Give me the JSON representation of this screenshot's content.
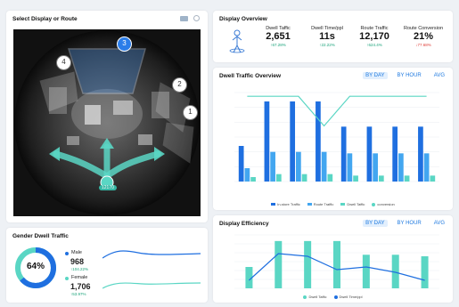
{
  "colors": {
    "blue": "#1f6fe0",
    "light_blue": "#43a6f0",
    "teal": "#5ad6c4",
    "down": "#e0403a",
    "up": "#1aa37a"
  },
  "camera": {
    "title": "Select Display or Route",
    "icons": [
      "grid-view-icon",
      "settings-icon"
    ],
    "zones": [
      {
        "label": "1"
      },
      {
        "label": "2"
      },
      {
        "label": "3"
      },
      {
        "label": "4"
      }
    ],
    "route_label": "12170"
  },
  "overview": {
    "title": "Display Overview",
    "icon": "person-display-icon",
    "metrics": [
      {
        "label": "Dwell Taffic",
        "value": "2,651",
        "delta": "↑67.28%",
        "trend": "up"
      },
      {
        "label": "Dwell Time/ppl",
        "value": "11s",
        "delta": "↑22.22%",
        "trend": "up"
      },
      {
        "label": "Route Traffic",
        "value": "12,170",
        "delta": "↑624.4%",
        "trend": "up"
      },
      {
        "label": "Route Conversion",
        "value": "21%",
        "delta": "↓77.68%",
        "trend": "down"
      }
    ]
  },
  "gender": {
    "title": "Gender Dwell Traffic",
    "ring_value": "64%",
    "male_share": 0.64,
    "male": {
      "label": "Male",
      "value": "968",
      "delta": "↑104.22%"
    },
    "female": {
      "label": "Female",
      "value": "1,706",
      "delta": "↑53.97%"
    }
  },
  "dwell_traffic": {
    "title": "Dwell Traffic Overview",
    "tabs": [
      "BY DAY",
      "BY HOUR",
      "AVG"
    ],
    "legend": [
      "In-store Traffic",
      "Route Traffic",
      "Dwell Taffic",
      "conversion"
    ]
  },
  "efficiency": {
    "title": "Display Efficiency",
    "tabs": [
      "BY DAY",
      "BY HOUR",
      "AVG"
    ],
    "legend": [
      "Dwell Taffic",
      "Dwell Time/ppl"
    ]
  },
  "chart_data": [
    {
      "type": "bar",
      "categories": [
        "",
        "",
        "",
        "",
        "",
        "",
        "",
        ""
      ],
      "ylim": [
        0,
        6000
      ],
      "y2lim": [
        0,
        12
      ],
      "grid": true,
      "legend": "bottom",
      "series": [
        {
          "name": "In-store Traffic",
          "type": "bar",
          "values": [
            2400,
            5400,
            5400,
            5400,
            3700,
            3700,
            3700,
            3700
          ]
        },
        {
          "name": "Route Traffic",
          "type": "bar",
          "values": [
            900,
            2000,
            2000,
            2000,
            1900,
            1900,
            1900,
            1900
          ]
        },
        {
          "name": "Dwell Taffic",
          "type": "bar",
          "values": [
            300,
            500,
            500,
            500,
            400,
            400,
            400,
            400
          ]
        },
        {
          "name": "conversion",
          "type": "line",
          "values": [
            11.5,
            11.5,
            11.5,
            7.5,
            11.5,
            11.5,
            11.5,
            11.5
          ]
        }
      ]
    },
    {
      "type": "bar",
      "categories": [
        "",
        "",
        "",
        "",
        "",
        "",
        ""
      ],
      "ylim": [
        0,
        350
      ],
      "y2lim": [
        0,
        20
      ],
      "grid": true,
      "legend": "bottom",
      "series": [
        {
          "name": "Dwell Taffic",
          "type": "bar",
          "values": [
            140,
            310,
            310,
            310,
            220,
            220,
            210
          ]
        },
        {
          "name": "Dwell Time/ppl",
          "type": "line",
          "values": [
            3,
            13,
            12,
            7,
            8,
            6,
            3
          ]
        }
      ]
    }
  ]
}
